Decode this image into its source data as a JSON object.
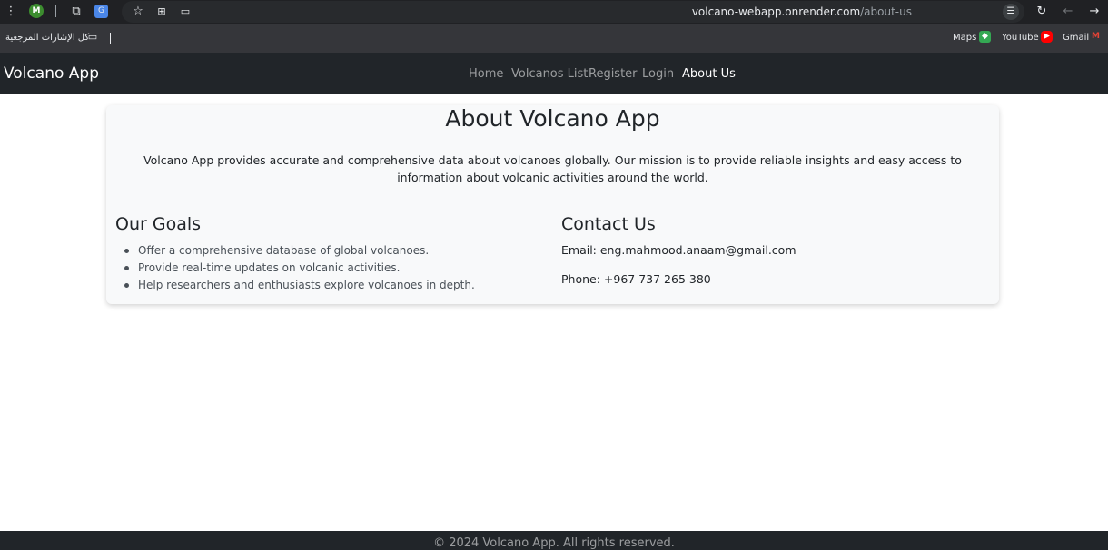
{
  "browser": {
    "avatar_letter": "M",
    "url_host": "volcano-webapp.onrender.com",
    "url_path": "/about-us"
  },
  "bookmarks": {
    "all_bookmarks": "كل الإشارات المرجعية",
    "items": [
      {
        "label": "Maps",
        "icon": "maps-icon"
      },
      {
        "label": "YouTube",
        "icon": "youtube-icon"
      },
      {
        "label": "Gmail",
        "icon": "gmail-icon"
      }
    ]
  },
  "navbar": {
    "brand": "Volcano App",
    "links": [
      "Home",
      "Volcanos List",
      "Register",
      "Login",
      "About Us"
    ],
    "active": "About Us"
  },
  "about": {
    "title": "About Volcano App",
    "intro": "Volcano App provides accurate and comprehensive data about volcanoes globally. Our mission is to provide reliable insights and easy access to information about volcanic activities around the world.",
    "goals": {
      "heading": "Our Goals",
      "items": [
        "Offer a comprehensive database of global volcanoes.",
        "Provide real-time updates on volcanic activities.",
        "Help researchers and enthusiasts explore volcanoes in depth."
      ]
    },
    "contact": {
      "heading": "Contact Us",
      "email": "Email: eng.mahmood.anaam@gmail.com",
      "phone": "Phone: +967 737 265 380"
    }
  },
  "footer": {
    "text": "© 2024 Volcano App. All rights reserved."
  }
}
